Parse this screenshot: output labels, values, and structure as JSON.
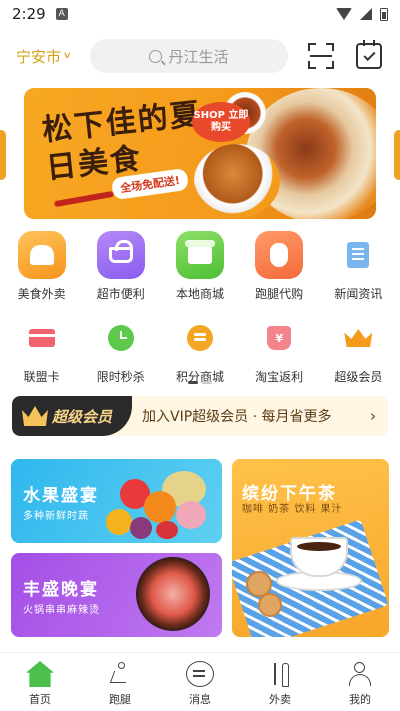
{
  "status_bar": {
    "time": "2:29",
    "notification_icon": "A"
  },
  "header": {
    "city": "宁安市",
    "search_placeholder": "丹江生活",
    "icons": [
      "scan-icon",
      "calendar-check-icon"
    ]
  },
  "banner": {
    "title": "松下佳的夏日美食",
    "shop_badge": "SHOP 立即购买",
    "tag": "全场免配送!",
    "accent_color": "#f59b1c"
  },
  "grid_row1": [
    {
      "label": "美食外卖",
      "icon": "chef-hat-icon"
    },
    {
      "label": "超市便利",
      "icon": "basket-icon"
    },
    {
      "label": "本地商城",
      "icon": "store-icon"
    },
    {
      "label": "跑腿代购",
      "icon": "footprint-icon"
    },
    {
      "label": "新闻资讯",
      "icon": "news-icon"
    }
  ],
  "grid_row2": [
    {
      "label": "联盟卡",
      "icon": "card-icon"
    },
    {
      "label": "限时秒杀",
      "icon": "alarm-clock-icon"
    },
    {
      "label": "积分商城",
      "icon": "coin-icon"
    },
    {
      "label": "淘宝返利",
      "icon": "bag-icon",
      "glyph": "¥"
    },
    {
      "label": "超级会员",
      "icon": "crown-icon"
    }
  ],
  "vip": {
    "badge": "超级会员",
    "text": "加入VIP超级会员 · 每月省更多",
    "arrow": "›"
  },
  "promos": {
    "fruit": {
      "title": "水果盛宴",
      "subtitle": "多种新鲜时蔬"
    },
    "dinner": {
      "title": "丰盛晚宴",
      "subtitle": "火锅串串麻辣烫"
    },
    "tea": {
      "title": "缤纷下午茶",
      "subtitle": "咖啡 奶茶 饮料 果汁"
    }
  },
  "tabbar": [
    {
      "label": "首页",
      "icon": "home-icon",
      "active": true
    },
    {
      "label": "跑腿",
      "icon": "runner-icon"
    },
    {
      "label": "消息",
      "icon": "message-icon"
    },
    {
      "label": "外卖",
      "icon": "fork-knife-icon"
    },
    {
      "label": "我的",
      "icon": "person-icon"
    }
  ]
}
